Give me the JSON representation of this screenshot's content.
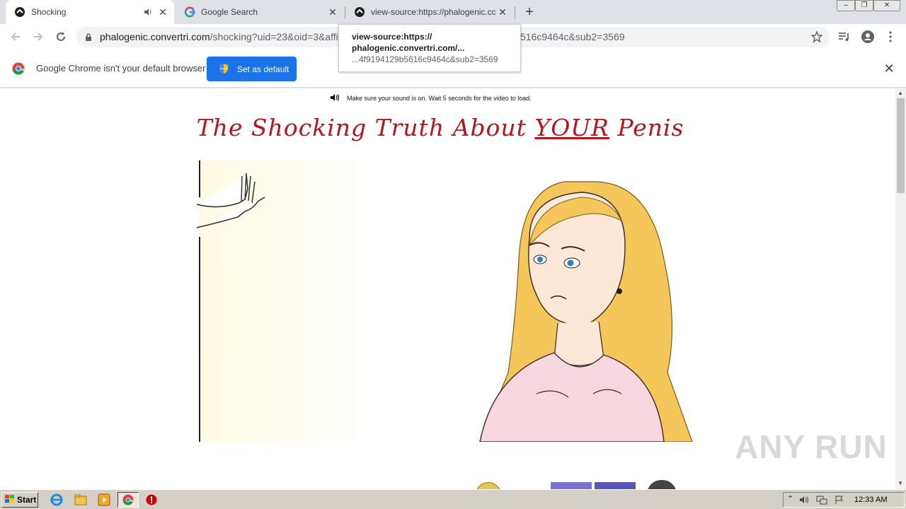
{
  "tabs": [
    {
      "title": "Shocking",
      "active": true,
      "audio": true
    },
    {
      "title": "Google Search",
      "active": false
    },
    {
      "title": "view-source:https://phalogenic.conv",
      "active": false
    }
  ],
  "toolbar": {
    "url_host": "phalogenic.convertri.com",
    "url_path": "/shocking?uid=23&oid=3&affi",
    "url_tail": "516c9464c&sub2=3569"
  },
  "tooltip": {
    "line1": "view-source:https://",
    "line2": "phalogenic.convertri.com/...",
    "line3": "...4f9194129b5616c9464c&sub2=3569"
  },
  "infobar": {
    "message": "Google Chrome isn't your default browser",
    "button_label": "Set as default"
  },
  "page": {
    "sound_note": "Make sure your sound is on. Wait 5 seconds for the video to load.",
    "headline_pre": "The Shocking Truth About ",
    "headline_emph": "YOUR",
    "headline_post": " Penis"
  },
  "watermark": "ANY RUN",
  "taskbar": {
    "start_label": "Start",
    "clock": "12:33 AM"
  },
  "colors": {
    "headline": "#b4161b",
    "accent_button": "#1a73e8",
    "tabstrip": "#dee1e6"
  }
}
